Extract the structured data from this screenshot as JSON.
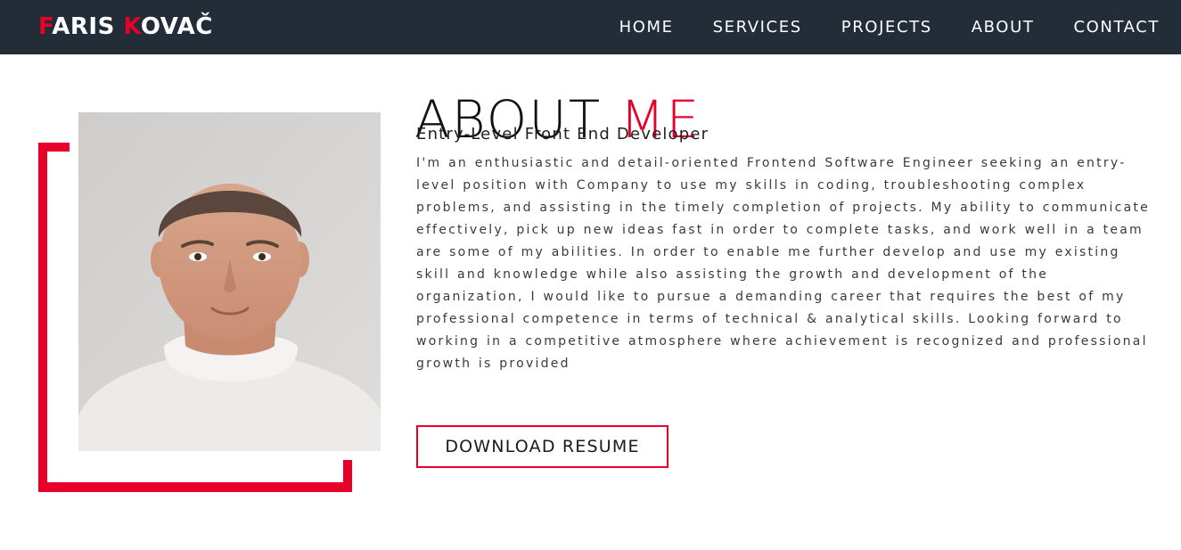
{
  "navbar": {
    "logo": {
      "first_initial": "F",
      "first_rest": "ARIS ",
      "last_initial": "K",
      "last_rest": "OVAČ"
    },
    "links": [
      {
        "label": "HOME"
      },
      {
        "label": "SERVICES"
      },
      {
        "label": "PROJECTS"
      },
      {
        "label": "ABOUT"
      },
      {
        "label": "CONTACT"
      }
    ]
  },
  "about": {
    "title_main": "ABOUT ",
    "title_accent": "ME",
    "subtitle": "Entry-Level Front End Developer",
    "bio": "I'm an enthusiastic and detail-oriented Frontend Software Engineer seeking an entry-level position with Company to use my skills in coding, troubleshooting complex problems, and assisting in the timely completion of projects. My ability to communicate effectively, pick up new ideas fast in order to complete tasks, and work well in a team are some of my abilities. In order to enable me further develop and use my existing skill and knowledge while also assisting the growth and development of the organization, I would like to pursue a demanding career that requires the best of my professional competence in terms of technical & analytical skills. Looking forward to working in a competitive atmosphere where achievement is recognized and professional growth is provided",
    "button_label": "DOWNLOAD RESUME"
  },
  "colors": {
    "accent": "#e8002a",
    "navbar_bg": "#222d38",
    "text": "#1f1f1f"
  }
}
